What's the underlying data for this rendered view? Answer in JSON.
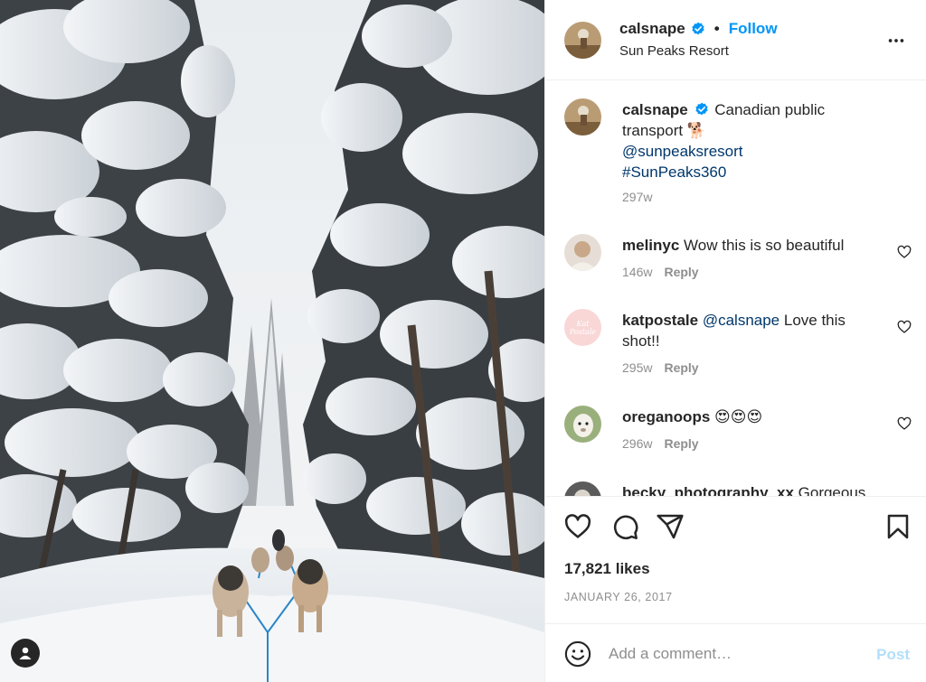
{
  "post": {
    "username": "calsnape",
    "follow_label": "Follow",
    "location": "Sun Peaks Resort",
    "dot": "•"
  },
  "comments": [
    {
      "username": "calsnape",
      "text": "Canadian public transport 🐕",
      "mention": "@sunpeaksresort",
      "hashtag": "#SunPeaks360",
      "time": "297w",
      "is_caption": true
    },
    {
      "username": "melinyc",
      "text": "Wow this is so beautiful",
      "time": "146w",
      "reply": "Reply"
    },
    {
      "username": "katpostale",
      "mention": "@calsnape",
      "text": "Love this shot!!",
      "time": "295w",
      "reply": "Reply",
      "avatar_text": "Kat Postale"
    },
    {
      "username": "oreganoops",
      "text": "😍😍😍",
      "time": "296w",
      "reply": "Reply"
    },
    {
      "username": "becky_photography_xx",
      "text": "Gorgeous"
    }
  ],
  "actions": {
    "likes": "17,821 likes",
    "date": "JANUARY 26, 2017"
  },
  "add_comment": {
    "placeholder": "Add a comment…",
    "post_label": "Post"
  },
  "colors": {
    "accent": "#0095f6",
    "link": "#00376b",
    "muted": "#8e8e8e",
    "post_disabled": "#b2dffc"
  }
}
